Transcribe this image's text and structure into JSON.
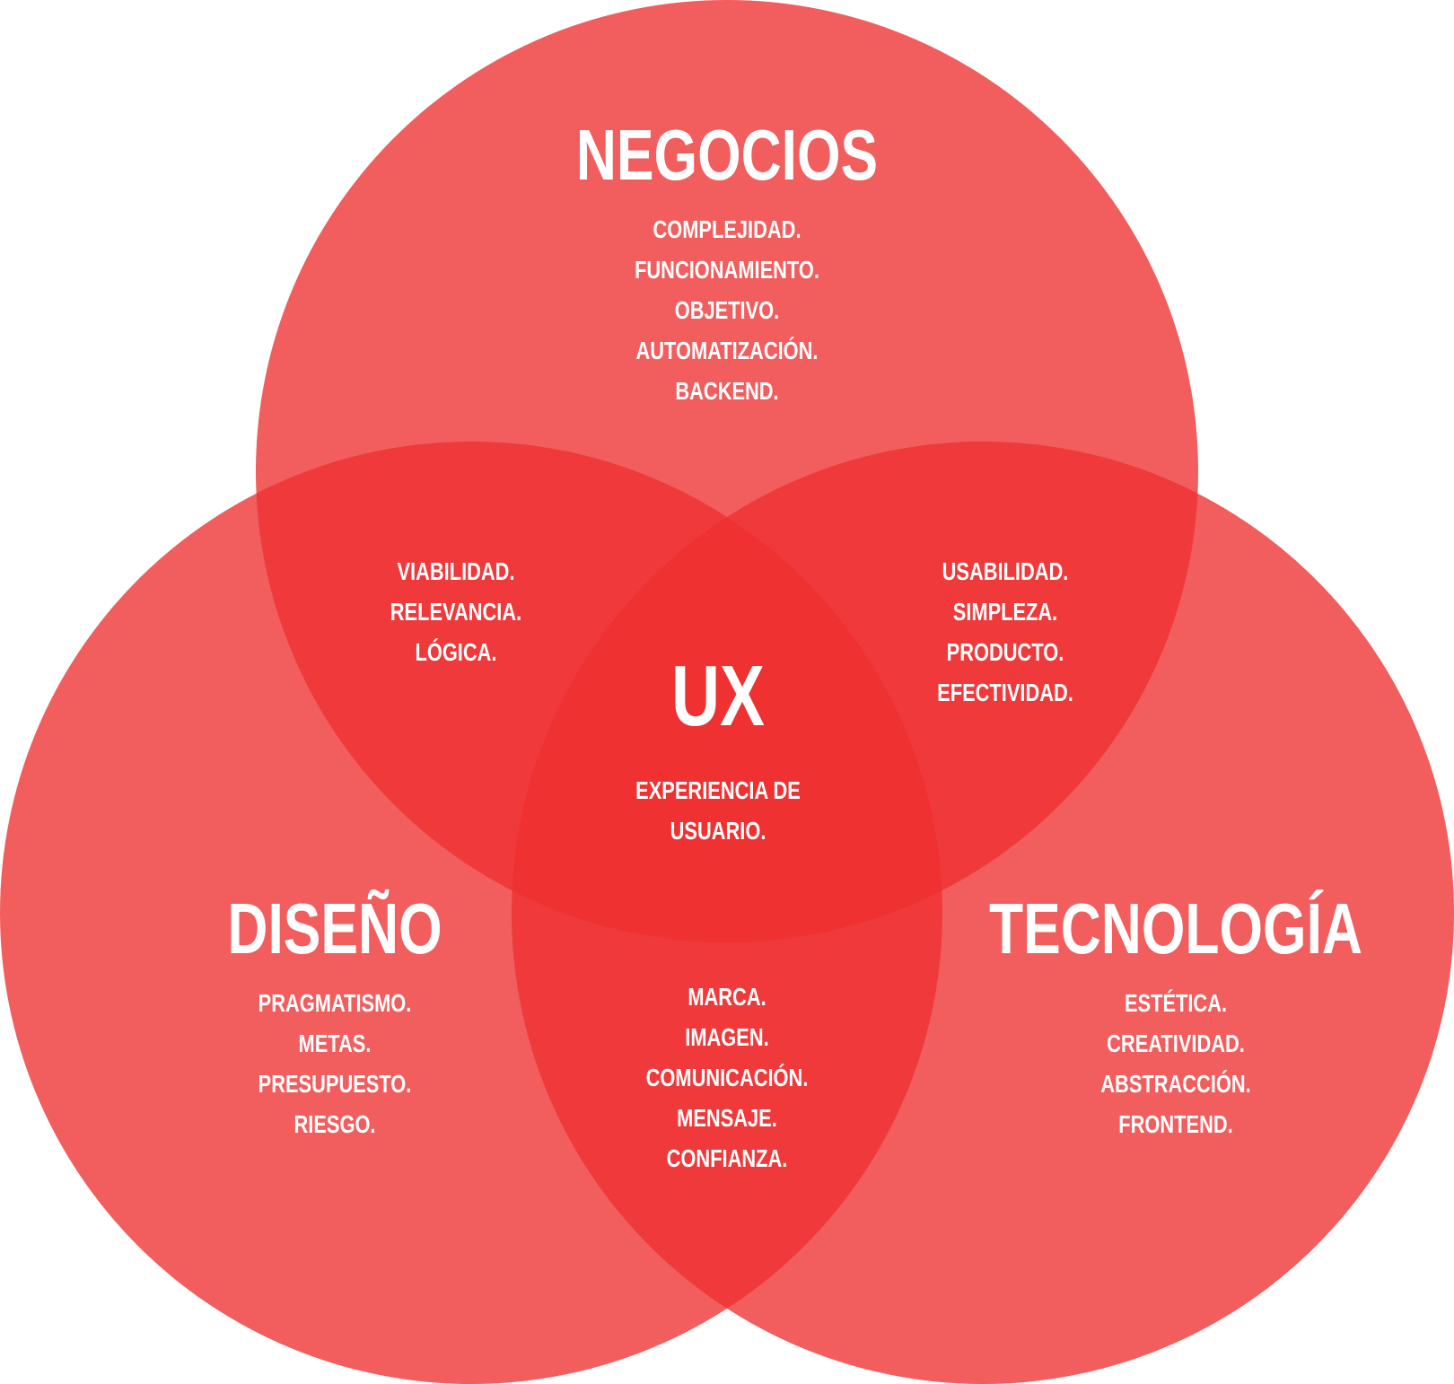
{
  "colors": {
    "circle": "#ee2f31",
    "circle_opacity": 0.78,
    "text": "#ffffff"
  },
  "sets": {
    "business": {
      "title": "NEGOCIOS",
      "items": [
        "COMPLEJIDAD.",
        "FUNCIONAMIENTO.",
        "OBJETIVO.",
        "AUTOMATIZACIÓN.",
        "BACKEND."
      ]
    },
    "design": {
      "title": "DISEÑO",
      "items": [
        "PRAGMATISMO.",
        "METAS.",
        "PRESUPUESTO.",
        "RIESGO."
      ]
    },
    "technology": {
      "title": "TECNOLOGÍA",
      "items": [
        "ESTÉTICA.",
        "CREATIVIDAD.",
        "ABSTRACCIÓN.",
        "FRONTEND."
      ]
    }
  },
  "overlaps": {
    "business_design": [
      "VIABILIDAD.",
      "RELEVANCIA.",
      "LÓGICA."
    ],
    "business_technology": [
      "USABILIDAD.",
      "SIMPLEZA.",
      "PRODUCTO.",
      "EFECTIVIDAD."
    ],
    "design_technology": [
      "MARCA.",
      "IMAGEN.",
      "COMUNICACIÓN.",
      "MENSAJE.",
      "CONFIANZA."
    ]
  },
  "center": {
    "title": "UX",
    "subtitle_line1": "EXPERIENCIA DE",
    "subtitle_line2": "USUARIO."
  }
}
